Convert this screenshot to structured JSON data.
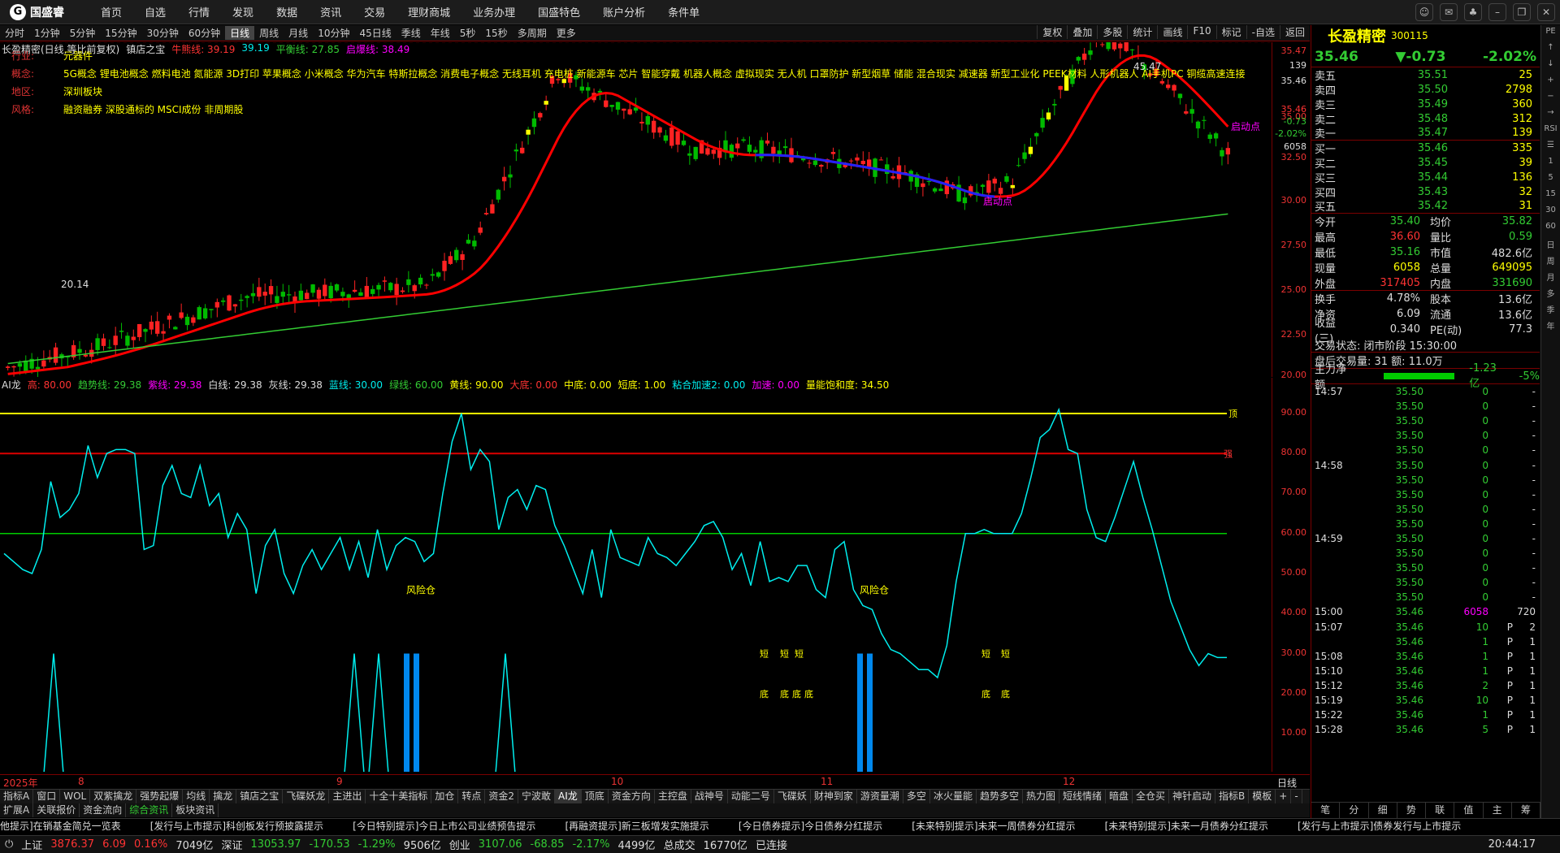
{
  "app": {
    "logo": "国盛睿"
  },
  "menu": [
    "首页",
    "自选",
    "行情",
    "发现",
    "数据",
    "资讯",
    "交易",
    "理财商城",
    "业务办理",
    "国盛特色",
    "账户分析",
    "条件单"
  ],
  "periods": [
    "分时",
    "1分钟",
    "5分钟",
    "15分钟",
    "30分钟",
    "60分钟",
    "日线",
    "周线",
    "月线",
    "10分钟",
    "45日线",
    "季线",
    "年线",
    "5秒",
    "15秒",
    "多周期",
    "更多"
  ],
  "period_active": "日线",
  "right_tools": [
    "复权",
    "叠加",
    "多股",
    "统计",
    "画线",
    "F10",
    "标记",
    "-自选",
    "返回"
  ],
  "chart1_title": {
    "name": "长盈精密(日线,等比前复权)",
    "indicator": "镇店之宝",
    "l1": "牛熊线: 39.19",
    "l2": "39.19",
    "l3": "平衡线: 27.85",
    "l4": "启爆线: 38.49"
  },
  "stock_info": [
    {
      "k": "行业:",
      "v": "元器件"
    },
    {
      "k": "概念:",
      "v": "5G概念 锂电池概念 燃料电池 氮能源 3D打印 苹果概念 小米概念 华为汽车 特斯拉概念 消费电子概念 无线耳机 充电桩 新能源车 芯片 智能穿戴 机器人概念 虚拟现实 无人机 口罩防护 新型烟草 储能 混合现实 减速器 新型工业化 PEEK材料 人形机器人 AI手机PC 铜缆高速连接"
    },
    {
      "k": "地区:",
      "v": "深圳板块"
    },
    {
      "k": "风格:",
      "v": "融资融券 深股通标的 MSCI成份 非周期股"
    }
  ],
  "chart1_labels": {
    "high": "45.47",
    "low": "20.14",
    "start": "启动点"
  },
  "chart1_yticks": [
    "35.47",
    "35.00",
    "32.50",
    "30.00",
    "27.50",
    "25.00",
    "22.50",
    "20.00"
  ],
  "chart1_axis_extra": [
    "139",
    "35.46",
    "35.46",
    "-0.73",
    "-2.02%",
    "6058"
  ],
  "chart2_title": [
    {
      "t": "AI龙",
      "c": "w"
    },
    {
      "t": "高: 80.00",
      "c": "r"
    },
    {
      "t": "趋势线: 29.38",
      "c": "g"
    },
    {
      "t": "紫线: 29.38",
      "c": "m"
    },
    {
      "t": "白线: 29.38",
      "c": "w"
    },
    {
      "t": "灰线: 29.38",
      "c": "w"
    },
    {
      "t": "蓝线: 30.00",
      "c": "c"
    },
    {
      "t": "绿线: 60.00",
      "c": "g"
    },
    {
      "t": "黄线: 90.00",
      "c": "y"
    },
    {
      "t": "大底: 0.00",
      "c": "r"
    },
    {
      "t": "中底: 0.00",
      "c": "y"
    },
    {
      "t": "短底: 1.00",
      "c": "y"
    },
    {
      "t": "粘合加速2: 0.00",
      "c": "c"
    },
    {
      "t": "加速: 0.00",
      "c": "m"
    },
    {
      "t": "量能饱和度: 34.50",
      "c": "y"
    }
  ],
  "chart2_yticks": [
    "90.00",
    "80.00",
    "70.00",
    "60.00",
    "50.00",
    "40.00",
    "30.00",
    "20.00",
    "10.00"
  ],
  "chart2_labels": {
    "top": "顶",
    "strong": "强",
    "fork": "风险仓",
    "short": "短",
    "bottom": "底"
  },
  "x_axis": [
    "2025年",
    "8",
    "9",
    "10",
    "11",
    "12",
    "日线"
  ],
  "tabs1": [
    "指标A",
    "窗口",
    "WOL",
    "双紫擒龙",
    "强势起爆",
    "均线",
    "擒龙",
    "镇店之宝",
    "飞碟妖龙",
    "主进出",
    "十全十美指标",
    "加仓",
    "转点",
    "资金2",
    "宁波敢",
    "AI龙",
    "顶底",
    "资金方向",
    "主控盘",
    "战神号",
    "动能二号",
    "飞碟妖",
    "财神到家",
    "游资量潮",
    "多空",
    "冰火量能",
    "趋势多空",
    "热力图",
    "短线情绪",
    "暗盘",
    "全仓买",
    "神针启动",
    "指标B",
    "模板",
    "+",
    "-"
  ],
  "tab1_active": "AI龙",
  "tabs2": [
    "扩展A",
    "关联报价",
    "资金流向",
    "综合资讯",
    "板块资讯"
  ],
  "quote": {
    "name": "长盈精密",
    "code": "300115",
    "price": "35.46",
    "change": "▼-0.73",
    "pct": "-2.02%"
  },
  "asks": [
    {
      "l": "卖五",
      "p": "35.51",
      "v": "25"
    },
    {
      "l": "卖四",
      "p": "35.50",
      "v": "2798"
    },
    {
      "l": "卖三",
      "p": "35.49",
      "v": "360"
    },
    {
      "l": "卖二",
      "p": "35.48",
      "v": "312"
    },
    {
      "l": "卖一",
      "p": "35.47",
      "v": "139"
    }
  ],
  "bids": [
    {
      "l": "买一",
      "p": "35.46",
      "v": "335"
    },
    {
      "l": "买二",
      "p": "35.45",
      "v": "39"
    },
    {
      "l": "买三",
      "p": "35.44",
      "v": "136"
    },
    {
      "l": "买四",
      "p": "35.43",
      "v": "32"
    },
    {
      "l": "买五",
      "p": "35.42",
      "v": "31"
    }
  ],
  "stats": [
    {
      "a": "今开",
      "b": "35.40",
      "bc": "g",
      "c": "均价",
      "d": "35.82",
      "dc": "g"
    },
    {
      "a": "最高",
      "b": "36.60",
      "bc": "r",
      "c": "量比",
      "d": "0.59",
      "dc": "g"
    },
    {
      "a": "最低",
      "b": "35.16",
      "bc": "g",
      "c": "市值",
      "d": "482.6亿",
      "dc": "w"
    },
    {
      "a": "现量",
      "b": "6058",
      "bc": "y",
      "c": "总量",
      "d": "649095",
      "dc": "y"
    },
    {
      "a": "外盘",
      "b": "317405",
      "bc": "r",
      "c": "内盘",
      "d": "331690",
      "dc": "g"
    },
    {
      "a": "换手",
      "b": "4.78%",
      "bc": "w",
      "c": "股本",
      "d": "13.6亿",
      "dc": "w"
    },
    {
      "a": "净资",
      "b": "6.09",
      "bc": "w",
      "c": "流通",
      "d": "13.6亿",
      "dc": "w"
    },
    {
      "a": "收益(三)",
      "b": "0.340",
      "bc": "w",
      "c": "PE(动)",
      "d": "77.3",
      "dc": "w"
    }
  ],
  "trade_state": "交易状态: 闭市阶段 15:30:00",
  "after_hours": "盘后交易量: 31  额: 11.0万",
  "flow": {
    "label": "主力净额",
    "value": "-1.23亿",
    "pct": "-5%"
  },
  "ticks": [
    {
      "t": "14:57",
      "p": "35.50",
      "v": "0",
      "f": "",
      "n": "-"
    },
    {
      "t": "",
      "p": "35.50",
      "v": "0",
      "f": "",
      "n": "-"
    },
    {
      "t": "",
      "p": "35.50",
      "v": "0",
      "f": "",
      "n": "-"
    },
    {
      "t": "",
      "p": "35.50",
      "v": "0",
      "f": "",
      "n": "-"
    },
    {
      "t": "",
      "p": "35.50",
      "v": "0",
      "f": "",
      "n": "-"
    },
    {
      "t": "14:58",
      "p": "35.50",
      "v": "0",
      "f": "",
      "n": "-"
    },
    {
      "t": "",
      "p": "35.50",
      "v": "0",
      "f": "",
      "n": "-"
    },
    {
      "t": "",
      "p": "35.50",
      "v": "0",
      "f": "",
      "n": "-"
    },
    {
      "t": "",
      "p": "35.50",
      "v": "0",
      "f": "",
      "n": "-"
    },
    {
      "t": "",
      "p": "35.50",
      "v": "0",
      "f": "",
      "n": "-"
    },
    {
      "t": "14:59",
      "p": "35.50",
      "v": "0",
      "f": "",
      "n": "-"
    },
    {
      "t": "",
      "p": "35.50",
      "v": "0",
      "f": "",
      "n": "-"
    },
    {
      "t": "",
      "p": "35.50",
      "v": "0",
      "f": "",
      "n": "-"
    },
    {
      "t": "",
      "p": "35.50",
      "v": "0",
      "f": "",
      "n": "-"
    },
    {
      "t": "",
      "p": "35.50",
      "v": "0",
      "f": "",
      "n": "-"
    },
    {
      "t": "15:00",
      "p": "35.46",
      "v": "6058",
      "f": "",
      "n": "720"
    },
    {
      "t": "15:07",
      "p": "35.46",
      "v": "10",
      "f": "P",
      "n": "2"
    },
    {
      "t": "",
      "p": "35.46",
      "v": "1",
      "f": "P",
      "n": "1"
    },
    {
      "t": "15:08",
      "p": "35.46",
      "v": "1",
      "f": "P",
      "n": "1"
    },
    {
      "t": "15:10",
      "p": "35.46",
      "v": "1",
      "f": "P",
      "n": "1"
    },
    {
      "t": "15:12",
      "p": "35.46",
      "v": "2",
      "f": "P",
      "n": "1"
    },
    {
      "t": "15:19",
      "p": "35.46",
      "v": "10",
      "f": "P",
      "n": "1"
    },
    {
      "t": "15:22",
      "p": "35.46",
      "v": "1",
      "f": "P",
      "n": "1"
    },
    {
      "t": "15:28",
      "p": "35.46",
      "v": "5",
      "f": "P",
      "n": "1"
    }
  ],
  "rp_bottom": [
    "笔",
    "分",
    "细",
    "势",
    "联",
    "值",
    "主",
    "筹"
  ],
  "ticker": [
    "他提示]在销基金简兑一览表",
    "[发行与上市提示]科创板发行预披露提示",
    "[今日特别提示]今日上市公司业绩预告提示",
    "[再融资提示]新三板增发实施提示",
    "[今日债券提示]今日债券分红提示",
    "[未来特别提示]未来一周债券分红提示",
    "[未来特别提示]未来一月债券分红提示",
    "[发行与上市提示]债券发行与上市提示"
  ],
  "status": {
    "sh_name": "上证",
    "sh": "3876.37",
    "sh_chg": "6.09",
    "sh_pct": "0.16%",
    "sh_amt": "7049亿",
    "sz_name": "深证",
    "sz": "13053.97",
    "sz_chg": "-170.53",
    "sz_pct": "-1.29%",
    "sz_amt": "9506亿",
    "cy_name": "创业",
    "cy": "3107.06",
    "cy_chg": "-68.85",
    "cy_pct": "-2.17%",
    "cy_amt": "4499亿",
    "total_lbl": "总成交",
    "total": "16770亿",
    "conn": "已连接",
    "time": "20:44:17"
  },
  "sidebar": [
    "PE",
    "↑",
    "↓",
    "+",
    "−",
    "→",
    "RSI",
    "☰",
    "1",
    "5",
    "15",
    "30",
    "60",
    "日",
    "周",
    "月",
    "多",
    "季",
    "年"
  ]
}
